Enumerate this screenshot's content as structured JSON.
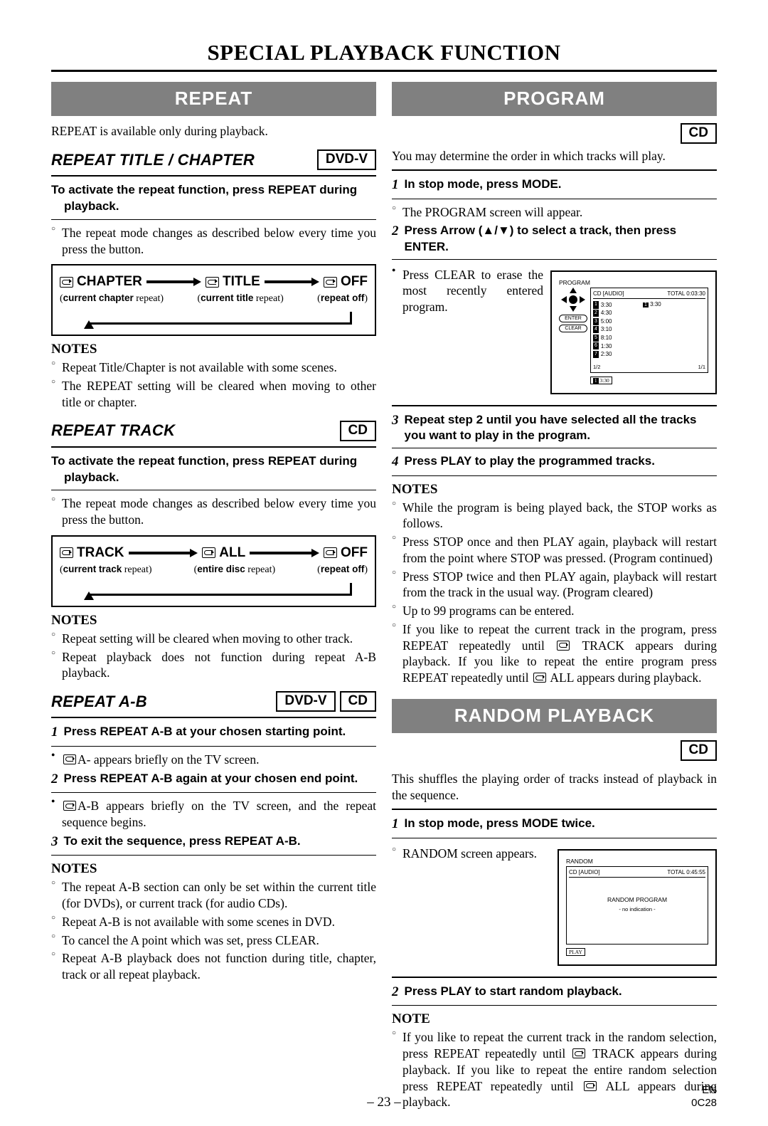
{
  "page": {
    "title": "SPECIAL PLAYBACK FUNCTION",
    "page_number": "– 23 –",
    "footer_code_1": "EN",
    "footer_code_2": "0C28"
  },
  "left": {
    "repeat": {
      "band": "REPEAT",
      "intro": "REPEAT is available only during playback.",
      "title_chapter": {
        "heading": "REPEAT TITLE / CHAPTER",
        "badge": "DVD-V",
        "instruction": "To activate the repeat function, press REPEAT during playback.",
        "bullet": "The repeat mode changes as described below every time you press the button.",
        "flow": {
          "items": [
            "CHAPTER",
            "TITLE",
            "OFF"
          ],
          "captions": [
            {
              "pre": "(",
              "bold": "current chapter",
              "post": " repeat)"
            },
            {
              "pre": "(",
              "bold": "current title",
              "post": " repeat)"
            },
            {
              "pre": "(",
              "bold": "repeat off",
              "post": ")"
            }
          ]
        },
        "notes_heading": "NOTES",
        "notes": [
          "Repeat Title/Chapter is not available with some scenes.",
          "The REPEAT setting will be cleared when moving to other title or chapter."
        ]
      },
      "track": {
        "heading": "REPEAT TRACK",
        "badge": "CD",
        "instruction": "To activate the repeat function, press REPEAT during playback.",
        "bullet": "The repeat mode changes as described below every time you press the button.",
        "flow": {
          "items": [
            "TRACK",
            "ALL",
            "OFF"
          ],
          "captions": [
            {
              "pre": "(",
              "bold": "current track",
              "post": " repeat)"
            },
            {
              "pre": "(",
              "bold": "entire disc",
              "post": " repeat)"
            },
            {
              "pre": "(",
              "bold": "repeat off",
              "post": ")"
            }
          ]
        },
        "notes_heading": "NOTES",
        "notes": [
          "Repeat setting will be cleared when moving to other track.",
          "Repeat playback does not function during repeat A-B playback."
        ]
      },
      "ab": {
        "heading": "REPEAT A-B",
        "badges": [
          "DVD-V",
          "CD"
        ],
        "step1_num": "1",
        "step1": "Press REPEAT A-B at your chosen starting point.",
        "bullet1_post": "A- appears briefly on the TV screen.",
        "step2_num": "2",
        "step2": "Press REPEAT A-B again at your chosen end point.",
        "bullet2_post": "A-B appears briefly on the TV screen, and the repeat sequence begins.",
        "step3_num": "3",
        "step3": "To exit the sequence, press REPEAT A-B.",
        "notes_heading": "NOTES",
        "notes": [
          "The repeat A-B section can only be set within the current title (for DVDs), or current track (for audio CDs).",
          "Repeat A-B is not available with some scenes in DVD.",
          "To cancel the A point which was set, press CLEAR.",
          "Repeat A-B playback does not function during title, chapter, track or all repeat playback."
        ]
      }
    }
  },
  "right": {
    "program": {
      "band": "PROGRAM",
      "badge": "CD",
      "intro": "You may determine the order in which tracks will play.",
      "step1_num": "1",
      "step1": "In stop mode, press MODE.",
      "bullet1": "The PROGRAM screen will appear.",
      "step2_num": "2",
      "step2": "Press Arrow (▲/▼) to select a track, then press ENTER.",
      "bullet2": "Press CLEAR to erase the most recently entered program.",
      "step3_num": "3",
      "step3": "Repeat step 2 until you have selected all the tracks you want to play in the program.",
      "step4_num": "4",
      "step4": "Press PLAY to play the programmed tracks.",
      "notes_heading": "NOTES",
      "notes": [
        "While the program is being played back, the STOP works as follows.",
        "Press STOP once and then PLAY again, playback will restart from the point where STOP was pressed. (Program continued)",
        "Press STOP twice and then PLAY again, playback will restart from the track in the usual way. (Program cleared)",
        "Up to 99 programs can be entered."
      ],
      "note_repeat_a": "If you like to repeat the current track in the program, press REPEAT repeatedly until",
      "note_repeat_b": "TRACK appears during playback. If you like to repeat the entire program press REPEAT repeatedly until",
      "note_repeat_c": "ALL appears during playback.",
      "osd": {
        "label": "PROGRAM",
        "header_left": "CD [AUDIO]",
        "header_right": "TOTAL  0:03:30",
        "tracks": [
          {
            "n": "1",
            "t": "3:30"
          },
          {
            "n": "2",
            "t": "4:30"
          },
          {
            "n": "3",
            "t": "5:00"
          },
          {
            "n": "4",
            "t": "3:10"
          },
          {
            "n": "5",
            "t": "8:10"
          },
          {
            "n": "6",
            "t": "1:30"
          },
          {
            "n": "7",
            "t": "2:30"
          }
        ],
        "selected_num": "1",
        "selected_time": "3:30",
        "page_indicator": "1/2",
        "page_indicator2": "1/1",
        "buttons": [
          "ENTER",
          "CLEAR"
        ],
        "footer_num": "1",
        "footer_time": "3:30"
      }
    },
    "random": {
      "band": "RANDOM PLAYBACK",
      "badge": "CD",
      "intro": "This shuffles the playing order of tracks instead of playback in the sequence.",
      "step1_num": "1",
      "step1": "In stop mode, press MODE twice.",
      "bullet1": "RANDOM screen appears.",
      "step2_num": "2",
      "step2": "Press PLAY to start random playback.",
      "note_heading": "NOTE",
      "note_a": "If you like to repeat the current track in the random selection, press REPEAT repeatedly until",
      "note_b": "TRACK appears during playback. If you like to repeat the entire random selection press REPEAT repeatedly until",
      "note_c": "ALL appears during playback.",
      "osd": {
        "label": "RANDOM",
        "header_left": "CD [AUDIO]",
        "header_right": "TOTAL  0:45:55",
        "center": "RANDOM PROGRAM",
        "sub": "- no indication -",
        "button": "PLAY"
      }
    }
  }
}
